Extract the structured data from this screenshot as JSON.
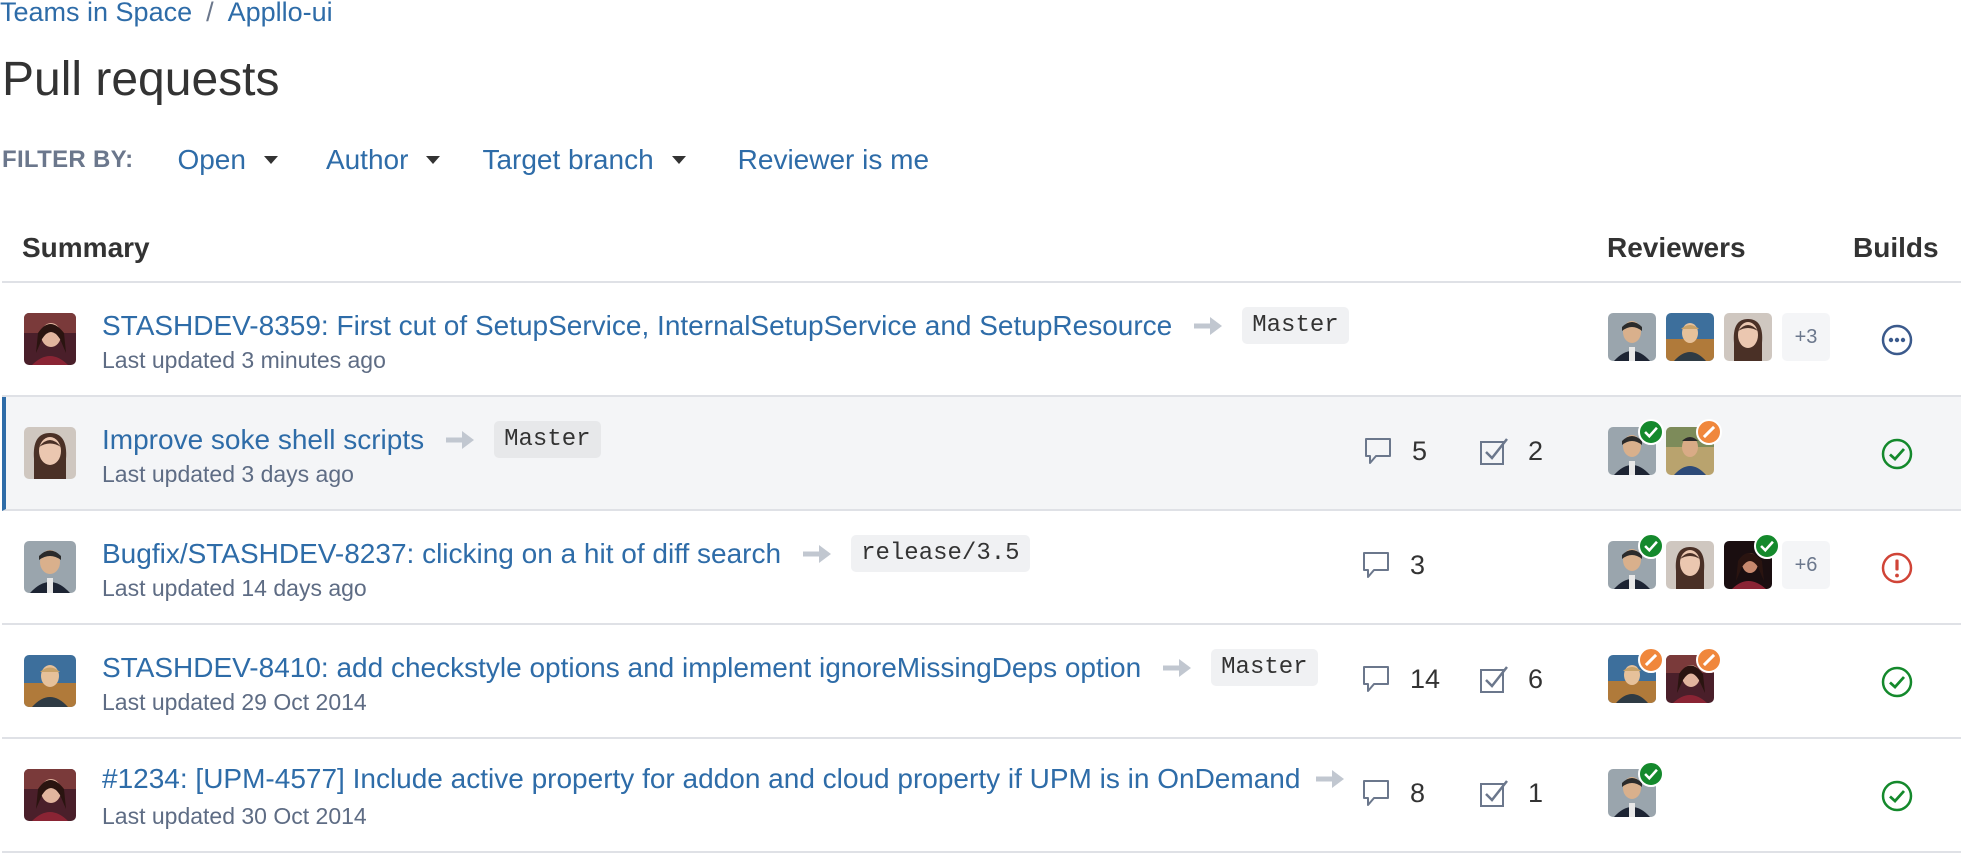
{
  "breadcrumb": {
    "project": "Teams in Space",
    "separator": "/",
    "repo": "Appllo-ui"
  },
  "page_title": "Pull requests",
  "filter_bar": {
    "label": "FILTER BY:",
    "filters": [
      {
        "label": "Open",
        "has_dropdown": true
      },
      {
        "label": "Author",
        "has_dropdown": true
      },
      {
        "label": "Target branch",
        "has_dropdown": true
      },
      {
        "label": "Reviewer is me",
        "has_dropdown": false
      }
    ]
  },
  "columns": {
    "summary": "Summary",
    "reviewers": "Reviewers",
    "builds": "Builds"
  },
  "colors": {
    "link": "#2e6ca8",
    "approved": "#14892c",
    "needs_work": "#f0873c",
    "build_failed": "#d04437",
    "build_in_progress": "#3b5a8c"
  },
  "pull_requests": [
    {
      "title": "STASHDEV-8359: First cut of SetupService, InternalSetupService and SetupResource",
      "target_branch": "Master",
      "updated": "Last updated 3 minutes ago",
      "comments": "",
      "tasks": "",
      "reviewers": [
        "none",
        "none",
        "none"
      ],
      "more_reviewers": "+3",
      "build": "in-progress",
      "highlighted": false
    },
    {
      "title": "Improve soke shell scripts",
      "target_branch": "Master",
      "updated": "Last updated 3 days ago",
      "comments": "5",
      "tasks": "2",
      "reviewers": [
        "approved",
        "needs-work"
      ],
      "more_reviewers": "",
      "build": "success",
      "highlighted": true
    },
    {
      "title": "Bugfix/STASHDEV-8237: clicking on a hit of diff search",
      "target_branch": "release/3.5",
      "updated": "Last updated 14 days ago",
      "comments": "3",
      "tasks": "",
      "reviewers": [
        "approved",
        "none",
        "approved"
      ],
      "more_reviewers": "+6",
      "build": "failed",
      "highlighted": false
    },
    {
      "title": "STASHDEV-8410: add checkstyle options and implement ignoreMissingDeps option",
      "target_branch": "Master",
      "updated": "Last updated 29 Oct 2014",
      "comments": "14",
      "tasks": "6",
      "reviewers": [
        "needs-work",
        "needs-work"
      ],
      "more_reviewers": "",
      "build": "success",
      "highlighted": false
    },
    {
      "title": "#1234: [UPM-4577] Include active property for addon and cloud property if UPM is in OnDemand",
      "target_branch": "",
      "updated": "Last updated 30 Oct 2014",
      "comments": "8",
      "tasks": "1",
      "reviewers": [
        "approved"
      ],
      "more_reviewers": "",
      "build": "success",
      "highlighted": false
    }
  ]
}
